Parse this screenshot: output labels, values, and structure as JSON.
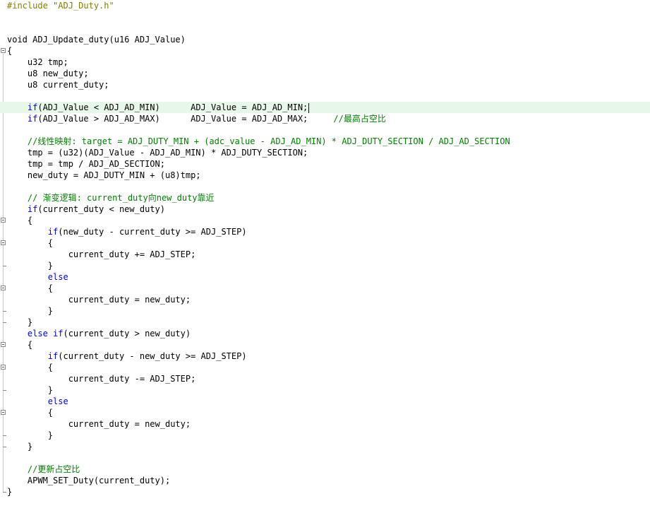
{
  "editor": {
    "lines": [
      {
        "segments": [
          {
            "t": "#include \"ADJ_Duty.h\"",
            "c": "pp"
          }
        ]
      },
      {
        "segments": []
      },
      {
        "segments": []
      },
      {
        "segments": [
          {
            "t": "void ADJ_Update_duty(u16 ADJ_Value)",
            "c": ""
          }
        ]
      },
      {
        "segments": [
          {
            "t": "{",
            "c": ""
          }
        ]
      },
      {
        "segments": [
          {
            "t": "    u32 tmp;",
            "c": ""
          }
        ]
      },
      {
        "segments": [
          {
            "t": "    u8 new_duty;",
            "c": ""
          }
        ]
      },
      {
        "segments": [
          {
            "t": "    u8 current_duty;",
            "c": ""
          }
        ]
      },
      {
        "segments": []
      },
      {
        "active": true,
        "cursor": true,
        "segments": [
          {
            "t": "    ",
            "c": ""
          },
          {
            "t": "if",
            "c": "kw"
          },
          {
            "t": "(ADJ_Value < ADJ_AD_MIN)      ADJ_Value = ADJ_AD_MIN;",
            "c": ""
          }
        ]
      },
      {
        "segments": [
          {
            "t": "    ",
            "c": ""
          },
          {
            "t": "if",
            "c": "kw"
          },
          {
            "t": "(ADJ_Value > ADJ_AD_MAX)      ADJ_Value = ADJ_AD_MAX;     ",
            "c": ""
          },
          {
            "t": "//最高占空比",
            "c": "cm"
          }
        ]
      },
      {
        "segments": []
      },
      {
        "segments": [
          {
            "t": "    ",
            "c": ""
          },
          {
            "t": "//线性映射: target = ADJ_DUTY_MIN + (adc_value - ADJ_AD_MIN) * ADJ_DUTY_SECTION / ADJ_AD_SECTION",
            "c": "cm"
          }
        ]
      },
      {
        "segments": [
          {
            "t": "    tmp = (u32)(ADJ_Value - ADJ_AD_MIN) * ADJ_DUTY_SECTION;",
            "c": ""
          }
        ]
      },
      {
        "segments": [
          {
            "t": "    tmp = tmp / ADJ_AD_SECTION;",
            "c": ""
          }
        ]
      },
      {
        "segments": [
          {
            "t": "    new_duty = ADJ_DUTY_MIN + (u8)tmp;",
            "c": ""
          }
        ]
      },
      {
        "segments": []
      },
      {
        "segments": [
          {
            "t": "    ",
            "c": ""
          },
          {
            "t": "// 渐变逻辑: current_duty向new_duty靠近",
            "c": "cm"
          }
        ]
      },
      {
        "segments": [
          {
            "t": "    ",
            "c": ""
          },
          {
            "t": "if",
            "c": "kw"
          },
          {
            "t": "(current_duty < new_duty)",
            "c": ""
          }
        ]
      },
      {
        "segments": [
          {
            "t": "    {",
            "c": ""
          }
        ]
      },
      {
        "segments": [
          {
            "t": "        ",
            "c": ""
          },
          {
            "t": "if",
            "c": "kw"
          },
          {
            "t": "(new_duty - current_duty >= ADJ_STEP)",
            "c": ""
          }
        ]
      },
      {
        "segments": [
          {
            "t": "        {",
            "c": ""
          }
        ]
      },
      {
        "segments": [
          {
            "t": "            current_duty += ADJ_STEP;",
            "c": ""
          }
        ]
      },
      {
        "segments": [
          {
            "t": "        }",
            "c": ""
          }
        ]
      },
      {
        "segments": [
          {
            "t": "        ",
            "c": ""
          },
          {
            "t": "else",
            "c": "kw"
          }
        ]
      },
      {
        "segments": [
          {
            "t": "        {",
            "c": ""
          }
        ]
      },
      {
        "segments": [
          {
            "t": "            current_duty = new_duty;",
            "c": ""
          }
        ]
      },
      {
        "segments": [
          {
            "t": "        }",
            "c": ""
          }
        ]
      },
      {
        "segments": [
          {
            "t": "    }",
            "c": ""
          }
        ]
      },
      {
        "segments": [
          {
            "t": "    ",
            "c": ""
          },
          {
            "t": "else if",
            "c": "kw"
          },
          {
            "t": "(current_duty > new_duty)",
            "c": ""
          }
        ]
      },
      {
        "segments": [
          {
            "t": "    {",
            "c": ""
          }
        ]
      },
      {
        "segments": [
          {
            "t": "        ",
            "c": ""
          },
          {
            "t": "if",
            "c": "kw"
          },
          {
            "t": "(current_duty - new_duty >= ADJ_STEP)",
            "c": ""
          }
        ]
      },
      {
        "segments": [
          {
            "t": "        {",
            "c": ""
          }
        ]
      },
      {
        "segments": [
          {
            "t": "            current_duty -= ADJ_STEP;",
            "c": ""
          }
        ]
      },
      {
        "segments": [
          {
            "t": "        }",
            "c": ""
          }
        ]
      },
      {
        "segments": [
          {
            "t": "        ",
            "c": ""
          },
          {
            "t": "else",
            "c": "kw"
          }
        ]
      },
      {
        "segments": [
          {
            "t": "        {",
            "c": ""
          }
        ]
      },
      {
        "segments": [
          {
            "t": "            current_duty = new_duty;",
            "c": ""
          }
        ]
      },
      {
        "segments": [
          {
            "t": "        }",
            "c": ""
          }
        ]
      },
      {
        "segments": [
          {
            "t": "    }",
            "c": ""
          }
        ]
      },
      {
        "segments": []
      },
      {
        "segments": [
          {
            "t": "    ",
            "c": ""
          },
          {
            "t": "//更新占空比",
            "c": "cm"
          }
        ]
      },
      {
        "segments": [
          {
            "t": "    APWM_SET_Duty(current_duty);",
            "c": ""
          }
        ]
      },
      {
        "segments": [
          {
            "t": "}",
            "c": ""
          }
        ]
      }
    ],
    "fold_markers": [
      "brace-open",
      "brace-open",
      "brace-open",
      "brace-open",
      "brace-open",
      "brace-open",
      "brace-open"
    ],
    "colors": {
      "keyword": "#0000ff",
      "comment": "#008000",
      "preprocessor": "#808000",
      "active_line": "#e8f8e8"
    }
  }
}
